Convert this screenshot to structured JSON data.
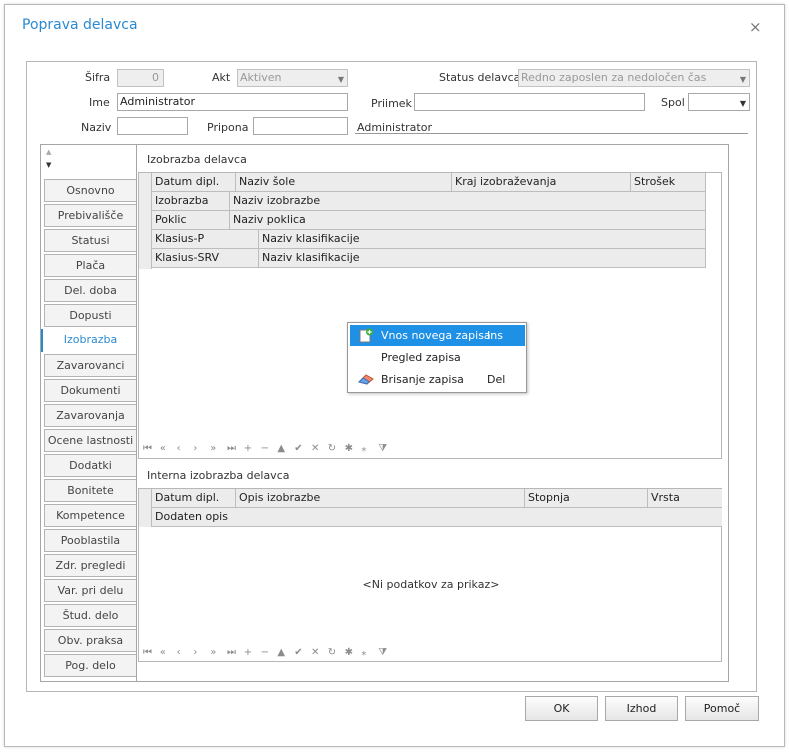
{
  "dialog": {
    "title": "Poprava delavca",
    "close": "×"
  },
  "header": {
    "sifra_label": "Šifra",
    "sifra_value": "0",
    "akt_label": "Akt",
    "akt_value": "Aktiven",
    "status_label": "Status delavca",
    "status_value": "Redno zaposlen za nedoločen čas",
    "ime_label": "Ime",
    "ime_value": "Administrator",
    "priimek_label": "Priimek",
    "priimek_value": "",
    "spol_label": "Spol",
    "spol_value": "",
    "naziv_label": "Naziv",
    "naziv_value": "",
    "pripona_label": "Pripona",
    "pripona_value": "",
    "display_name": "Administrator"
  },
  "tabs": [
    "Osnovno",
    "Prebivališče",
    "Statusi",
    "Plača",
    "Del. doba",
    "Dopusti",
    "Izobrazba",
    "Zavarovanci",
    "Dokumenti",
    "Zavarovanja",
    "Ocene lastnosti",
    "Dodatki",
    "Bonitete",
    "Kompetence",
    "Pooblastila",
    "Zdr. pregledi",
    "Var. pri delu",
    "Štud. delo",
    "Obv. praksa",
    "Pog. delo"
  ],
  "active_tab": "Izobrazba",
  "section1": {
    "title": "Izobrazba delavca",
    "header_row": [
      "Datum dipl.",
      "Naziv šole",
      "Kraj izobraževanja",
      "Strošek"
    ],
    "rows": [
      [
        "Izobrazba",
        "Naziv izobrazbe"
      ],
      [
        "Poklic",
        "Naziv poklica"
      ],
      [
        "Klasius-P",
        "Naziv klasifikacije"
      ],
      [
        "Klasius-SRV",
        "Naziv klasifikacije"
      ]
    ]
  },
  "context_menu": {
    "items": [
      {
        "label": "Vnos novega zapisa",
        "shortcut": "Ins",
        "icon": "new-record-icon",
        "highlighted": true
      },
      {
        "label": "Pregled zapisa",
        "shortcut": "",
        "icon": "",
        "highlighted": false
      },
      {
        "label": "Brisanje zapisa",
        "shortcut": "Del",
        "icon": "eraser-icon",
        "highlighted": false
      }
    ]
  },
  "navigator": {
    "buttons": [
      "first",
      "prev-page",
      "prev",
      "next",
      "next-page",
      "last",
      "insert",
      "delete",
      "edit",
      "post",
      "cancel",
      "refresh",
      "save-bookmark",
      "goto-bookmark",
      "filter"
    ],
    "glyphs": [
      "⏮",
      "«",
      "‹",
      "›",
      "»",
      "⏭",
      "+",
      "−",
      "▲",
      "✔",
      "✕",
      "↻",
      "✱",
      "⁎",
      "⧩"
    ]
  },
  "section2": {
    "title": "Interna izobrazba delavca",
    "header_row": [
      "Datum dipl.",
      "Opis izobrazbe",
      "Stopnja",
      "Vrsta"
    ],
    "sub_row": "Dodaten opis",
    "empty_text": "<Ni podatkov za prikaz>"
  },
  "buttons": {
    "ok": "OK",
    "izhod": "Izhod",
    "pomoc": "Pomoč"
  },
  "colors": {
    "accent": "#2a8ad0",
    "highlight": "#1e90e6"
  }
}
